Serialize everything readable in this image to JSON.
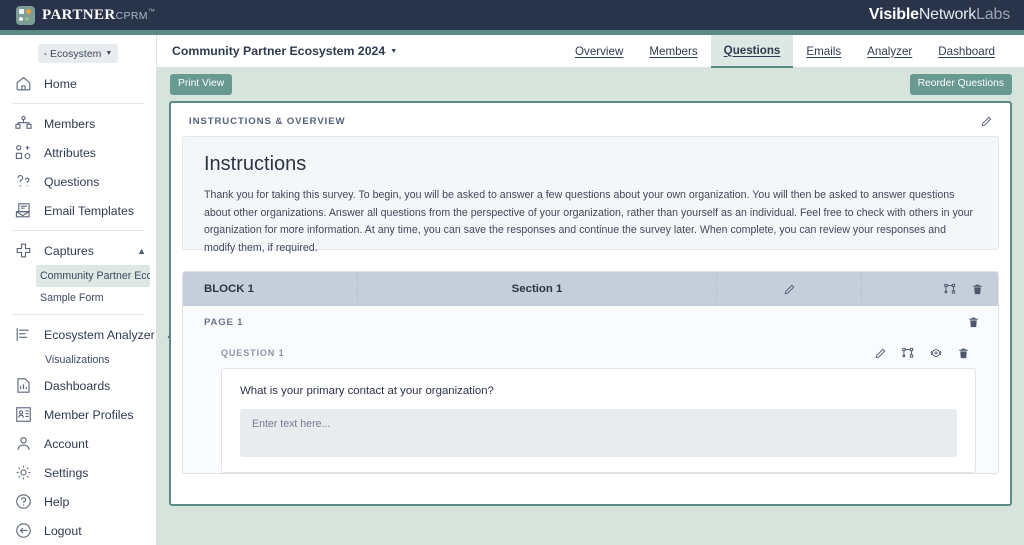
{
  "brand": {
    "name_bold": "PARTNER",
    "name_light": "CPRM",
    "trademark": "™",
    "logo_icon": "partner-cprm-logo-icon"
  },
  "vendor": {
    "part1": "Visible",
    "part2": "Network",
    "part3": "Labs"
  },
  "sidebar": {
    "ecosystem_selector": "- Ecosystem",
    "items": [
      {
        "label": "Home",
        "icon": "home-icon"
      },
      {
        "label": "Members",
        "icon": "members-icon"
      },
      {
        "label": "Attributes",
        "icon": "attributes-icon"
      },
      {
        "label": "Questions",
        "icon": "questions-icon"
      },
      {
        "label": "Email Templates",
        "icon": "email-template-icon"
      },
      {
        "label": "Captures",
        "icon": "captures-icon",
        "expanded": true
      },
      {
        "label": "Ecosystem Analyzer",
        "icon": "analyzer-icon",
        "expanded": true
      },
      {
        "label": "Dashboards",
        "icon": "dashboards-icon"
      },
      {
        "label": "Member Profiles",
        "icon": "member-profiles-icon"
      },
      {
        "label": "Account",
        "icon": "account-icon"
      },
      {
        "label": "Settings",
        "icon": "gear-icon"
      },
      {
        "label": "Help",
        "icon": "help-icon"
      },
      {
        "label": "Logout",
        "icon": "logout-icon"
      }
    ],
    "captures_children": [
      {
        "label": "Community Partner Ecos...",
        "active": true
      },
      {
        "label": "Sample Form",
        "active": false
      }
    ],
    "analyzer_children": [
      {
        "label": "Visualizations",
        "active": false
      }
    ]
  },
  "header": {
    "capture_title": "Community Partner Ecosystem 2024",
    "caret": "▾",
    "tabs": [
      {
        "label": "Overview",
        "active": false
      },
      {
        "label": "Members",
        "active": false
      },
      {
        "label": "Questions",
        "active": true
      },
      {
        "label": "Emails",
        "active": false
      },
      {
        "label": "Analyzer",
        "active": false
      },
      {
        "label": "Dashboard",
        "active": false
      }
    ]
  },
  "toolbar": {
    "print_view_label": "Print View",
    "reorder_questions_label": "Reorder Questions"
  },
  "instructions_section": {
    "section_label": "INSTRUCTIONS & OVERVIEW",
    "edit_icon": "pencil-icon",
    "heading": "Instructions",
    "body": "Thank you for taking this survey. To begin, you will be asked to answer a few questions about your own organization. You will then be asked to answer questions about other organizations. Answer all questions from the perspective of your organization, rather than yourself as an individual. Feel free to check with others in your organization for more information. At any time, you can save the responses and continue the survey later. When complete, you can review your responses and modify them, if required."
  },
  "block": {
    "block_label": "BLOCK 1",
    "section_label": "Section 1",
    "edit_icon": "pencil-icon",
    "logic_icon": "branch-logic-icon",
    "delete_icon": "trash-icon",
    "page": {
      "page_label": "PAGE 1",
      "delete_icon": "trash-icon",
      "questions": [
        {
          "question_label": "QUESTION 1",
          "text": "What is your primary contact at your organization?",
          "input_placeholder": "Enter text here...",
          "icons": [
            "pencil-icon",
            "branch-logic-icon",
            "add-circle-icon",
            "trash-icon"
          ]
        }
      ]
    }
  },
  "colors": {
    "topbar": "#29334a",
    "accent_teal": "#5b8b84",
    "button_teal": "#689a92",
    "active_tab_bg": "#dde8e4",
    "page_bg": "#d7e3dd",
    "block_header_bg": "#c6cedb"
  }
}
